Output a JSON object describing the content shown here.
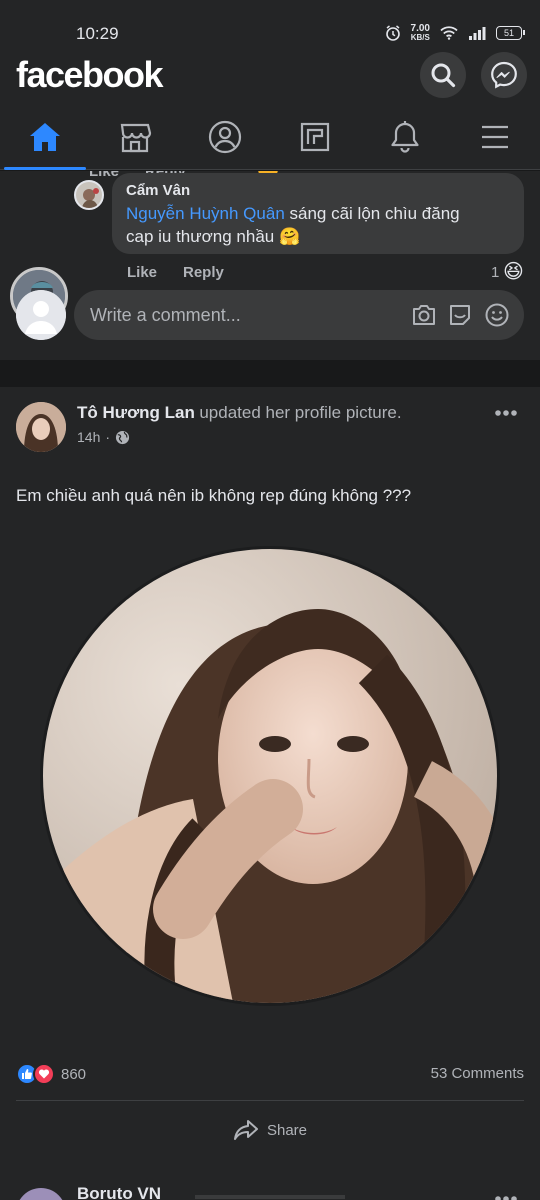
{
  "status_bar": {
    "time": "10:29",
    "speed_value": "7.00",
    "speed_unit": "KB/S",
    "battery": "51",
    "icons": [
      "alarm-icon",
      "wifi-icon",
      "signal-icon",
      "battery-icon"
    ]
  },
  "app_bar": {
    "logo": "facebook",
    "buttons": [
      "search-icon",
      "messenger-icon"
    ]
  },
  "tabs": [
    {
      "name": "home",
      "icon": "home-icon",
      "active": true
    },
    {
      "name": "marketplace",
      "icon": "store-icon",
      "active": false
    },
    {
      "name": "profile",
      "icon": "profile-icon",
      "active": false
    },
    {
      "name": "pages",
      "icon": "pages-icon",
      "active": false
    },
    {
      "name": "notifications",
      "icon": "bell-icon",
      "active": false
    },
    {
      "name": "menu",
      "icon": "menu-icon",
      "active": false
    }
  ],
  "comment_thread": {
    "prev_actions": {
      "like": "Like",
      "reply": "Reply"
    },
    "reply": {
      "author": "Cẩm Vân",
      "mention": "Nguyễn Huỳnh Quân",
      "text_line1": " sáng cãi lộn chìu đăng",
      "text_line2": "cap iu thương nhầu",
      "emoji": "🤗",
      "like_label": "Like",
      "reply_label": "Reply",
      "reaction_count": "1",
      "reaction_emoji": "😆"
    },
    "write_comment": {
      "placeholder": "Write a comment...",
      "icons": [
        "camera-icon",
        "gif-icon",
        "sticker-icon"
      ]
    }
  },
  "post": {
    "author": "Tô Hương Lan",
    "action": "updated her profile picture.",
    "time": "14h",
    "dot": "·",
    "privacy": "globe-icon",
    "text": "Em chiều anh quá nên ib không rep đúng không ???",
    "reactions": {
      "types": [
        "like",
        "love"
      ],
      "count": "860"
    },
    "comments": "53 Comments",
    "share_label": "Share",
    "colors": {
      "like": "#2d88ff",
      "love": "#f33e58"
    }
  },
  "next_post": {
    "author": "Boruto VN"
  }
}
